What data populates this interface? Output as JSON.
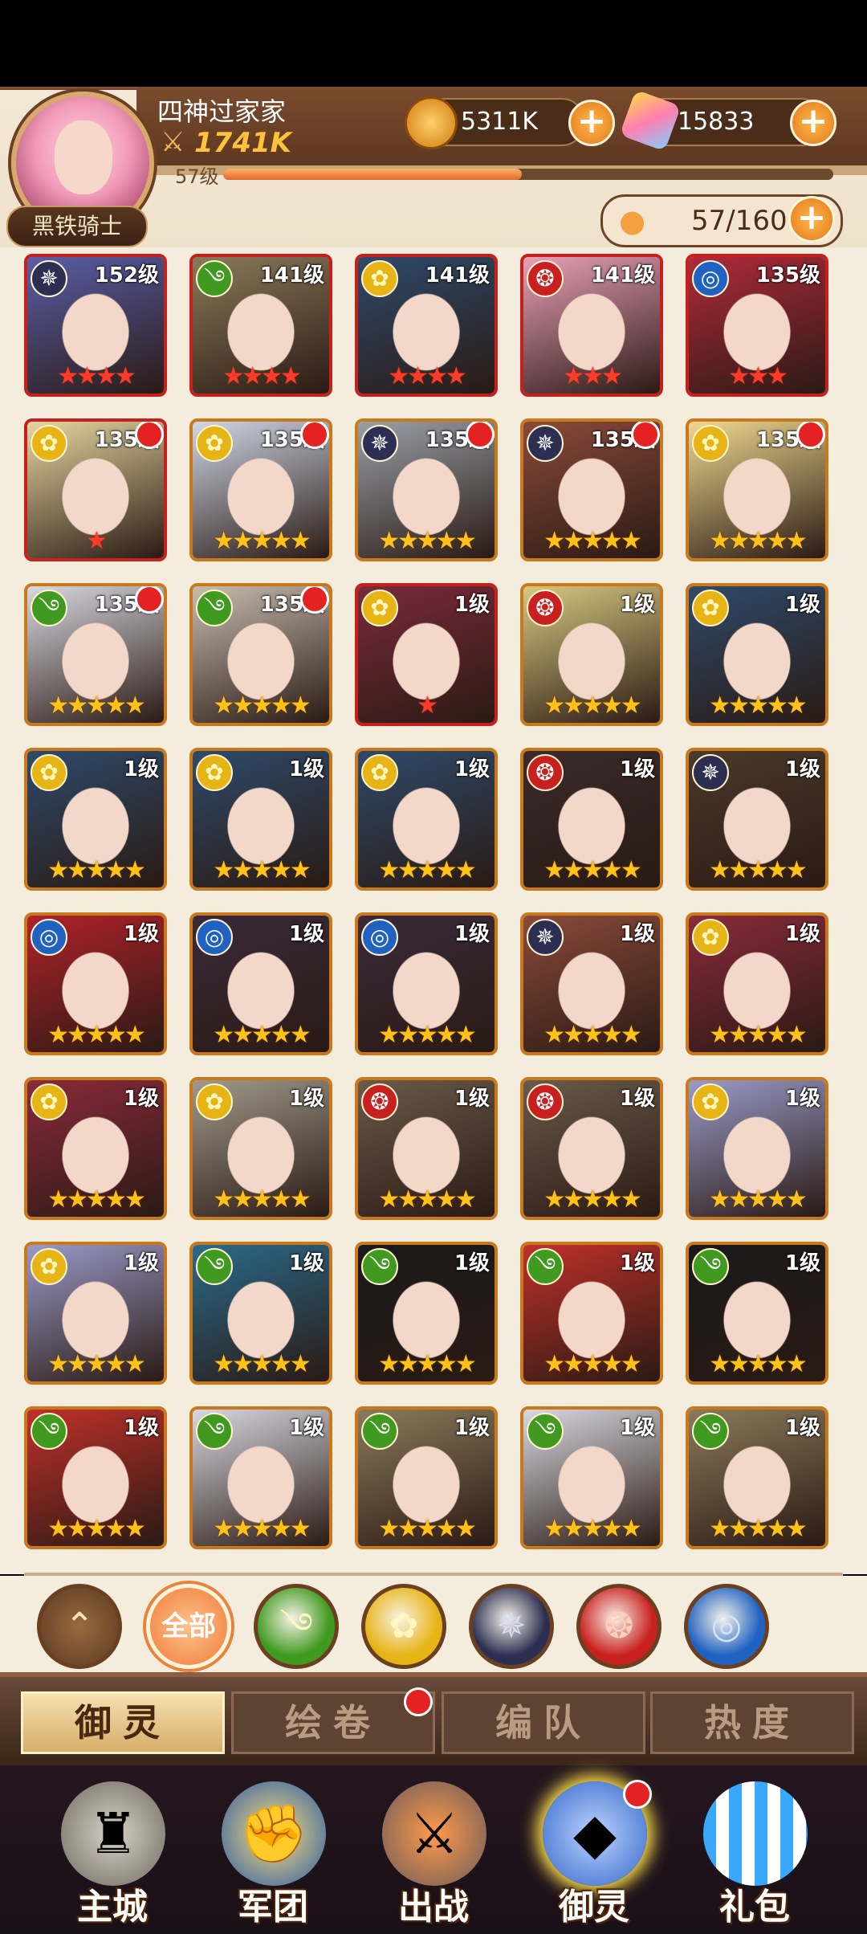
{
  "player": {
    "name": "四神过家家",
    "power": "1741K",
    "level": "57级",
    "xp_fraction": 0.49,
    "title_badge": "黑铁骑士"
  },
  "resources": {
    "gold": "5311K",
    "gems": "15833",
    "capacity": "57/160"
  },
  "cards": [
    {
      "level": "152级",
      "element": "shadow",
      "stars": 4,
      "frame": "red",
      "dot": false
    },
    {
      "level": "141级",
      "element": "wind",
      "stars": 4,
      "frame": "red",
      "dot": false
    },
    {
      "level": "141级",
      "element": "light",
      "stars": 4,
      "frame": "red",
      "dot": false
    },
    {
      "level": "141级",
      "element": "fire",
      "stars": 3,
      "frame": "red",
      "dot": false
    },
    {
      "level": "135级",
      "element": "water",
      "stars": 3,
      "frame": "red",
      "dot": false
    },
    {
      "level": "135级",
      "element": "light",
      "stars": 1,
      "frame": "red",
      "dot": true
    },
    {
      "level": "135级",
      "element": "light",
      "stars": 5,
      "frame": "gold",
      "dot": true
    },
    {
      "level": "135级",
      "element": "shadow",
      "stars": 5,
      "frame": "gold",
      "dot": true
    },
    {
      "level": "135级",
      "element": "shadow",
      "stars": 5,
      "frame": "gold",
      "dot": true
    },
    {
      "level": "135级",
      "element": "light",
      "stars": 5,
      "frame": "gold",
      "dot": true
    },
    {
      "level": "135级",
      "element": "wind",
      "stars": 5,
      "frame": "gold",
      "dot": true
    },
    {
      "level": "135级",
      "element": "wind",
      "stars": 5,
      "frame": "gold",
      "dot": true
    },
    {
      "level": "1级",
      "element": "light",
      "stars": 1,
      "frame": "red",
      "dot": false
    },
    {
      "level": "1级",
      "element": "fire",
      "stars": 5,
      "frame": "gold",
      "dot": false
    },
    {
      "level": "1级",
      "element": "light",
      "stars": 5,
      "frame": "gold",
      "dot": false
    },
    {
      "level": "1级",
      "element": "light",
      "stars": 5,
      "frame": "gold",
      "dot": false
    },
    {
      "level": "1级",
      "element": "light",
      "stars": 5,
      "frame": "gold",
      "dot": false
    },
    {
      "level": "1级",
      "element": "light",
      "stars": 5,
      "frame": "gold",
      "dot": false
    },
    {
      "level": "1级",
      "element": "fire",
      "stars": 5,
      "frame": "gold",
      "dot": false
    },
    {
      "level": "1级",
      "element": "shadow",
      "stars": 5,
      "frame": "gold",
      "dot": false
    },
    {
      "level": "1级",
      "element": "water",
      "stars": 5,
      "frame": "gold",
      "dot": false
    },
    {
      "level": "1级",
      "element": "water",
      "stars": 5,
      "frame": "gold",
      "dot": false
    },
    {
      "level": "1级",
      "element": "water",
      "stars": 5,
      "frame": "gold",
      "dot": false
    },
    {
      "level": "1级",
      "element": "shadow",
      "stars": 5,
      "frame": "gold",
      "dot": false
    },
    {
      "level": "1级",
      "element": "light",
      "stars": 5,
      "frame": "gold",
      "dot": false
    },
    {
      "level": "1级",
      "element": "light",
      "stars": 5,
      "frame": "gold",
      "dot": false
    },
    {
      "level": "1级",
      "element": "light",
      "stars": 5,
      "frame": "gold",
      "dot": false
    },
    {
      "level": "1级",
      "element": "fire",
      "stars": 5,
      "frame": "gold",
      "dot": false
    },
    {
      "level": "1级",
      "element": "fire",
      "stars": 5,
      "frame": "gold",
      "dot": false
    },
    {
      "level": "1级",
      "element": "light",
      "stars": 5,
      "frame": "gold",
      "dot": false
    },
    {
      "level": "1级",
      "element": "light",
      "stars": 5,
      "frame": "gold",
      "dot": false
    },
    {
      "level": "1级",
      "element": "wind",
      "stars": 5,
      "frame": "gold",
      "dot": false
    },
    {
      "level": "1级",
      "element": "wind",
      "stars": 5,
      "frame": "gold",
      "dot": false
    },
    {
      "level": "1级",
      "element": "wind",
      "stars": 5,
      "frame": "gold",
      "dot": false
    },
    {
      "level": "1级",
      "element": "wind",
      "stars": 5,
      "frame": "gold",
      "dot": false
    },
    {
      "level": "1级",
      "element": "wind",
      "stars": 5,
      "frame": "gold",
      "dot": false
    },
    {
      "level": "1级",
      "element": "wind",
      "stars": 5,
      "frame": "gold",
      "dot": false
    },
    {
      "level": "1级",
      "element": "wind",
      "stars": 5,
      "frame": "gold",
      "dot": false
    },
    {
      "level": "1级",
      "element": "wind",
      "stars": 5,
      "frame": "gold",
      "dot": false
    },
    {
      "level": "1级",
      "element": "wind",
      "stars": 5,
      "frame": "gold",
      "dot": false
    }
  ],
  "filters": {
    "collapse_icon": "chevron-up-icon",
    "all_label": "全部",
    "elements": [
      "wind",
      "light",
      "shadow",
      "fire",
      "water"
    ]
  },
  "tabs": [
    {
      "label": "御灵",
      "active": true,
      "dot": false
    },
    {
      "label": "绘卷",
      "active": false,
      "dot": true
    },
    {
      "label": "编队",
      "active": false,
      "dot": false
    },
    {
      "label": "热度",
      "active": false,
      "dot": false
    }
  ],
  "nav": [
    {
      "label": "主城",
      "icon": "castle-icon",
      "active": false,
      "dot": false
    },
    {
      "label": "军团",
      "icon": "fist-shield-icon",
      "active": false,
      "dot": false
    },
    {
      "label": "出战",
      "icon": "sword-gate-icon",
      "active": false,
      "dot": false
    },
    {
      "label": "御灵",
      "icon": "crystal-icon",
      "active": true,
      "dot": true
    },
    {
      "label": "礼包",
      "icon": "shop-icon",
      "active": false,
      "dot": false
    }
  ],
  "colors": {
    "element_wind": "#3f9a1f",
    "element_light": "#e7b416",
    "element_shadow": "#2c2f52",
    "element_fire": "#c8201e",
    "element_water": "#1f62c2",
    "accent_orange": "#f07c3c"
  }
}
